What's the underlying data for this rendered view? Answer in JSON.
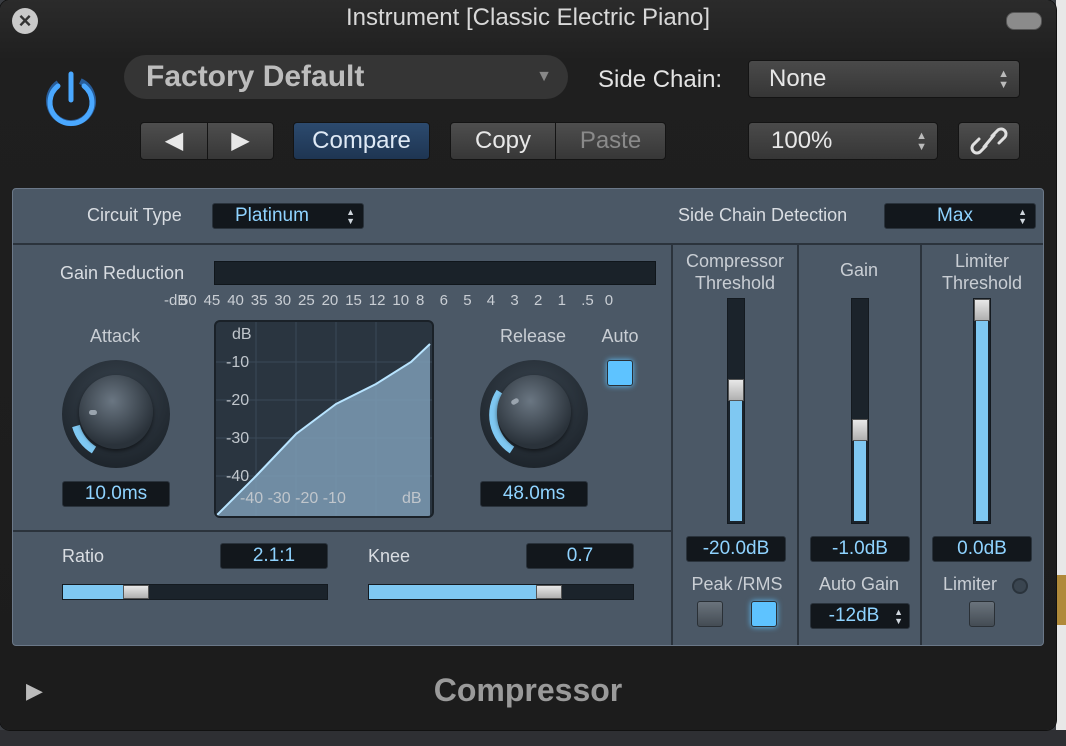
{
  "window": {
    "title": "Instrument [Classic Electric Piano]"
  },
  "header": {
    "preset": "Factory Default",
    "side_chain_label": "Side Chain:",
    "side_chain_value": "None",
    "compare_label": "Compare",
    "copy_label": "Copy",
    "paste_label": "Paste",
    "zoom_value": "100%"
  },
  "panel": {
    "circuit_type_label": "Circuit Type",
    "circuit_type_value": "Platinum",
    "sc_detection_label": "Side Chain Detection",
    "sc_detection_value": "Max",
    "gain_reduction_label": "Gain Reduction",
    "gr_scale": [
      "-dB",
      "50",
      "45",
      "40",
      "35",
      "30",
      "25",
      "20",
      "15",
      "12",
      "10",
      "8",
      "6",
      "5",
      "4",
      "3",
      "2",
      "1",
      ".5",
      "0"
    ],
    "attack_label": "Attack",
    "attack_value": "10.0ms",
    "release_label": "Release",
    "release_value": "48.0ms",
    "auto_label": "Auto",
    "graph": {
      "y_unit": "dB",
      "y_ticks": [
        "-10",
        "-20",
        "-30",
        "-40"
      ],
      "x_ticks": "-40 -30 -20 -10",
      "x_unit": "dB"
    },
    "ratio_label": "Ratio",
    "ratio_value": "2.1:1",
    "knee_label": "Knee",
    "knee_value": "0.7",
    "comp_threshold_label_1": "Compressor",
    "comp_threshold_label_2": "Threshold",
    "comp_threshold_value": "-20.0dB",
    "gain_label": "Gain",
    "gain_value": "-1.0dB",
    "limiter_threshold_label_1": "Limiter",
    "limiter_threshold_label_2": "Threshold",
    "limiter_threshold_value": "0.0dB",
    "peak_rms_label": "Peak /RMS",
    "auto_gain_label": "Auto Gain",
    "auto_gain_value": "-12dB",
    "limiter_label": "Limiter"
  },
  "footer": {
    "plugin_name": "Compressor"
  },
  "levels": {
    "ratio_fraction": 0.25,
    "knee_fraction": 0.7,
    "comp_threshold_fraction": 0.6,
    "gain_fraction": 0.4,
    "limiter_threshold_fraction": 1.0
  },
  "colors": {
    "accent": "#5ec3ff",
    "power": "#2f8fff",
    "panel": "#4b5866"
  }
}
